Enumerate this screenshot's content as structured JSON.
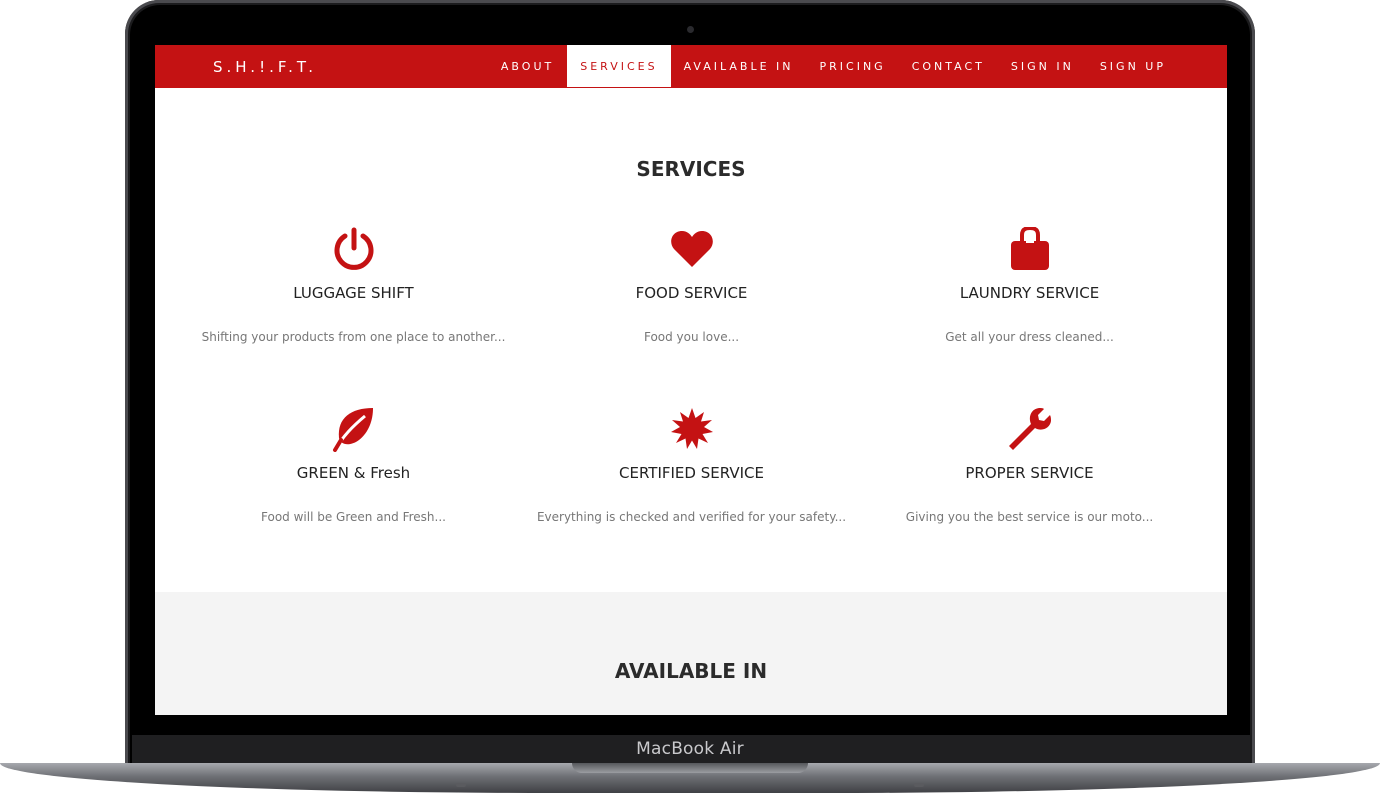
{
  "device": {
    "label": "MacBook Air"
  },
  "nav": {
    "logo": "S.H.!.F.T.",
    "items": [
      {
        "label": "ABOUT",
        "active": false
      },
      {
        "label": "SERVICES",
        "active": true
      },
      {
        "label": "AVAILABLE IN",
        "active": false
      },
      {
        "label": "PRICING",
        "active": false
      },
      {
        "label": "CONTACT",
        "active": false
      },
      {
        "label": "SIGN IN",
        "active": false
      },
      {
        "label": "SIGN UP",
        "active": false
      }
    ]
  },
  "services": {
    "heading": "SERVICES",
    "cards": [
      {
        "icon": "power-icon",
        "title": "LUGGAGE SHIFT",
        "desc": "Shifting your products from one place to another..."
      },
      {
        "icon": "heart-icon",
        "title": "FOOD SERVICE",
        "desc": "Food you love..."
      },
      {
        "icon": "bag-icon",
        "title": "LAUNDRY SERVICE",
        "desc": "Get all your dress cleaned..."
      },
      {
        "icon": "leaf-icon",
        "title": "GREEN & Fresh",
        "desc": "Food will be Green and Fresh..."
      },
      {
        "icon": "badge-icon",
        "title": "CERTIFIED SERVICE",
        "desc": "Everything is checked and verified for your safety..."
      },
      {
        "icon": "wrench-icon",
        "title": "PROPER SERVICE",
        "desc": "Giving you the best service is our moto..."
      }
    ]
  },
  "available": {
    "heading": "AVAILABLE IN"
  },
  "colors": {
    "accent": "#c41213",
    "section_bg": "#f4f4f4"
  }
}
